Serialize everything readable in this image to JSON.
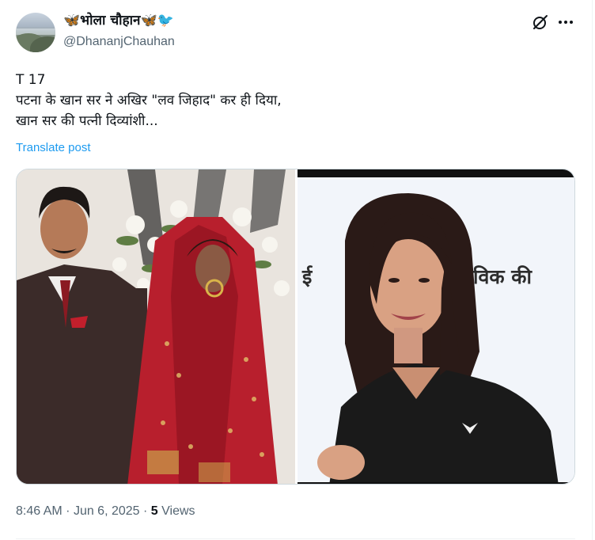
{
  "author": {
    "display_name_text": "भोला चौहान",
    "handle": "@DhananjChauhan",
    "name_emojis": [
      "butterfly-emoji",
      "butterfly-emoji",
      "bird-emoji"
    ]
  },
  "post": {
    "lines": [
      "T 17",
      "पटना के खान सर ने अखिर \"लव जिहाद\" कर ही दिया,",
      "खान सर की पत्नी दिव्यांशी..."
    ],
    "translate_label": "Translate post"
  },
  "media": {
    "right_caption_left": "ई",
    "right_caption_right": "विक की",
    "icons": [
      "grok-icon",
      "more-icon"
    ]
  },
  "meta": {
    "time": "8:46 AM",
    "sep1": "·",
    "date": "Jun 6, 2025",
    "sep2": "·",
    "views_count": "5",
    "views_label": "Views"
  },
  "colors": {
    "accent": "#1d9bf0",
    "secondary_text": "#536471",
    "primary_text": "#0f1419"
  }
}
